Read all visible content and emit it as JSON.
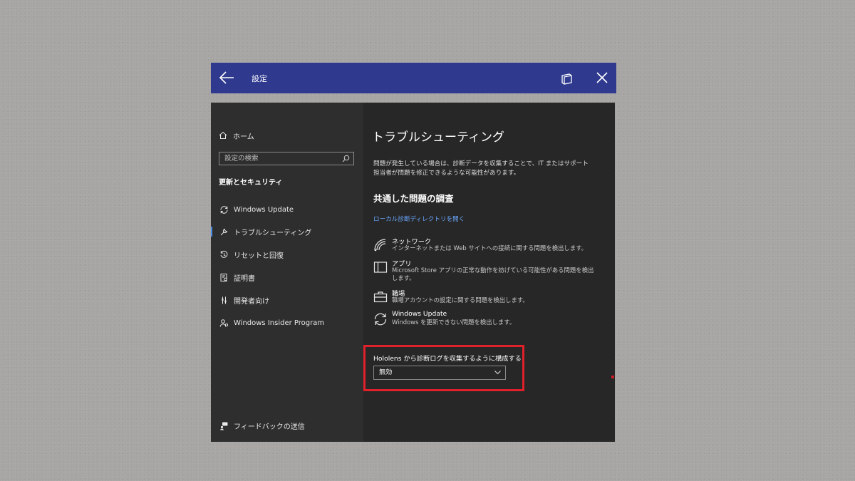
{
  "titlebar": {
    "title": "設定",
    "icons": {
      "back": "back-arrow-icon",
      "restore": "restore-window-icon",
      "close": "close-icon"
    }
  },
  "sidebar": {
    "home_label": "ホーム",
    "search_placeholder": "設定の検索",
    "section_title": "更新とセキュリティ",
    "items": [
      {
        "label": "Windows Update",
        "icon": "sync-icon"
      },
      {
        "label": "トラブルシューティング",
        "icon": "wrench-icon",
        "active": true
      },
      {
        "label": "リセットと回復",
        "icon": "history-icon"
      },
      {
        "label": "証明書",
        "icon": "certificate-icon"
      },
      {
        "label": "開発者向け",
        "icon": "developer-icon"
      },
      {
        "label": "Windows Insider Program",
        "icon": "insider-icon"
      }
    ],
    "feedback_label": "フィードバックの送信"
  },
  "main": {
    "title": "トラブルシューティング",
    "description": "問題が発生している場合は、診断データを収集することで、IT またはサポート担当者が問題を修正できるような可能性があります。",
    "section_title": "共通した問題の調査",
    "link_text": "ローカル診断ディレクトリを開く",
    "troubleshooters": [
      {
        "name": "ネットワーク",
        "desc": "インターネットまたは Web サイトへの接続に関する問題を検出します。",
        "icon": "wifi-icon"
      },
      {
        "name": "アプリ",
        "desc": "Microsoft Store アプリの正常な動作を妨げている可能性がある問題を検出します。",
        "icon": "app-window-icon"
      },
      {
        "name": "職場",
        "desc": "職場アカウントの設定に関する問題を検出します。",
        "icon": "briefcase-icon"
      },
      {
        "name": "Windows Update",
        "desc": "Windows を更新できない問題を検出します。",
        "icon": "sync-icon"
      }
    ],
    "diagnostic_label": "Hololens から診断ログを収集するように構成する",
    "diagnostic_value": "無効"
  },
  "colors": {
    "titlebar_bg": "#2f3a8f",
    "sidebar_bg": "#2e2e2e",
    "main_bg": "#272727",
    "link": "#6aa7ff",
    "highlight": "#e0202a",
    "active_indicator": "#4a8de8"
  }
}
